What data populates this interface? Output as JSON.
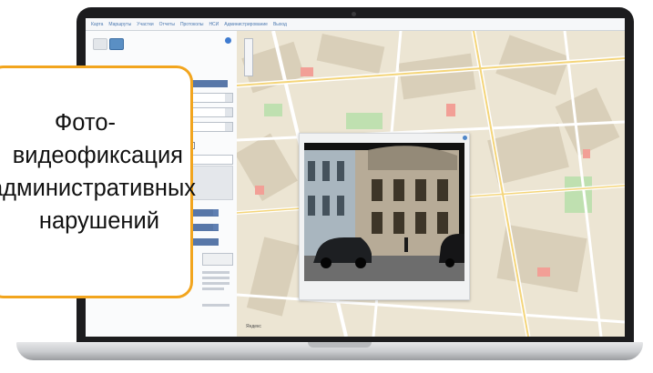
{
  "app": {
    "menu": [
      "Карта",
      "Маршруты",
      "Участки",
      "Отчеты",
      "Протоколы",
      "НСИ",
      "Администрирование",
      "Выход"
    ],
    "map_attribution": "Яндекс"
  },
  "callout": {
    "lines": [
      "Фото-",
      "видеофиксация",
      "административных",
      "нарушений"
    ]
  },
  "colors": {
    "callout_border": "#f2a51e",
    "laptop_frame": "#1c1c1e",
    "panel_accent": "#5a8fc4"
  },
  "icons": [
    "help-icon",
    "close-icon",
    "zoom-control"
  ]
}
